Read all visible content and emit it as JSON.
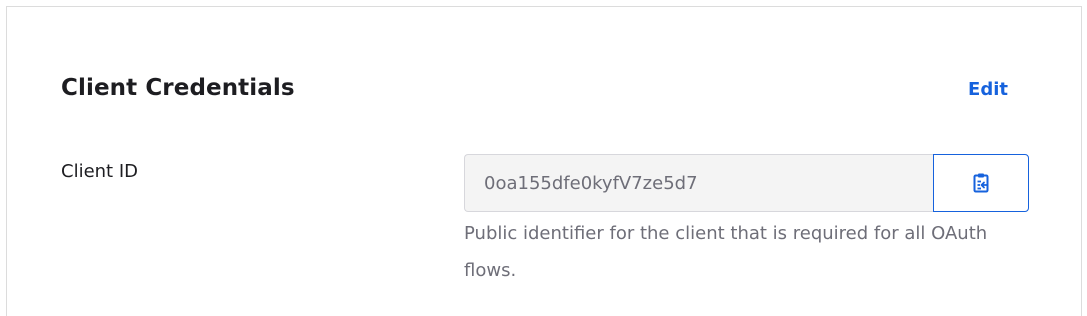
{
  "section": {
    "title": "Client Credentials",
    "edit_label": "Edit"
  },
  "client_id": {
    "label": "Client ID",
    "value": "0oa155dfe0kyfV7ze5d7",
    "help_text": "Public identifier for the client that is required for all OAuth flows.",
    "copy_icon": "clipboard-copy-icon"
  },
  "colors": {
    "accent": "#1662dd",
    "text": "#1d1d21",
    "muted": "#6e6e78",
    "input_bg": "#f4f4f4"
  }
}
